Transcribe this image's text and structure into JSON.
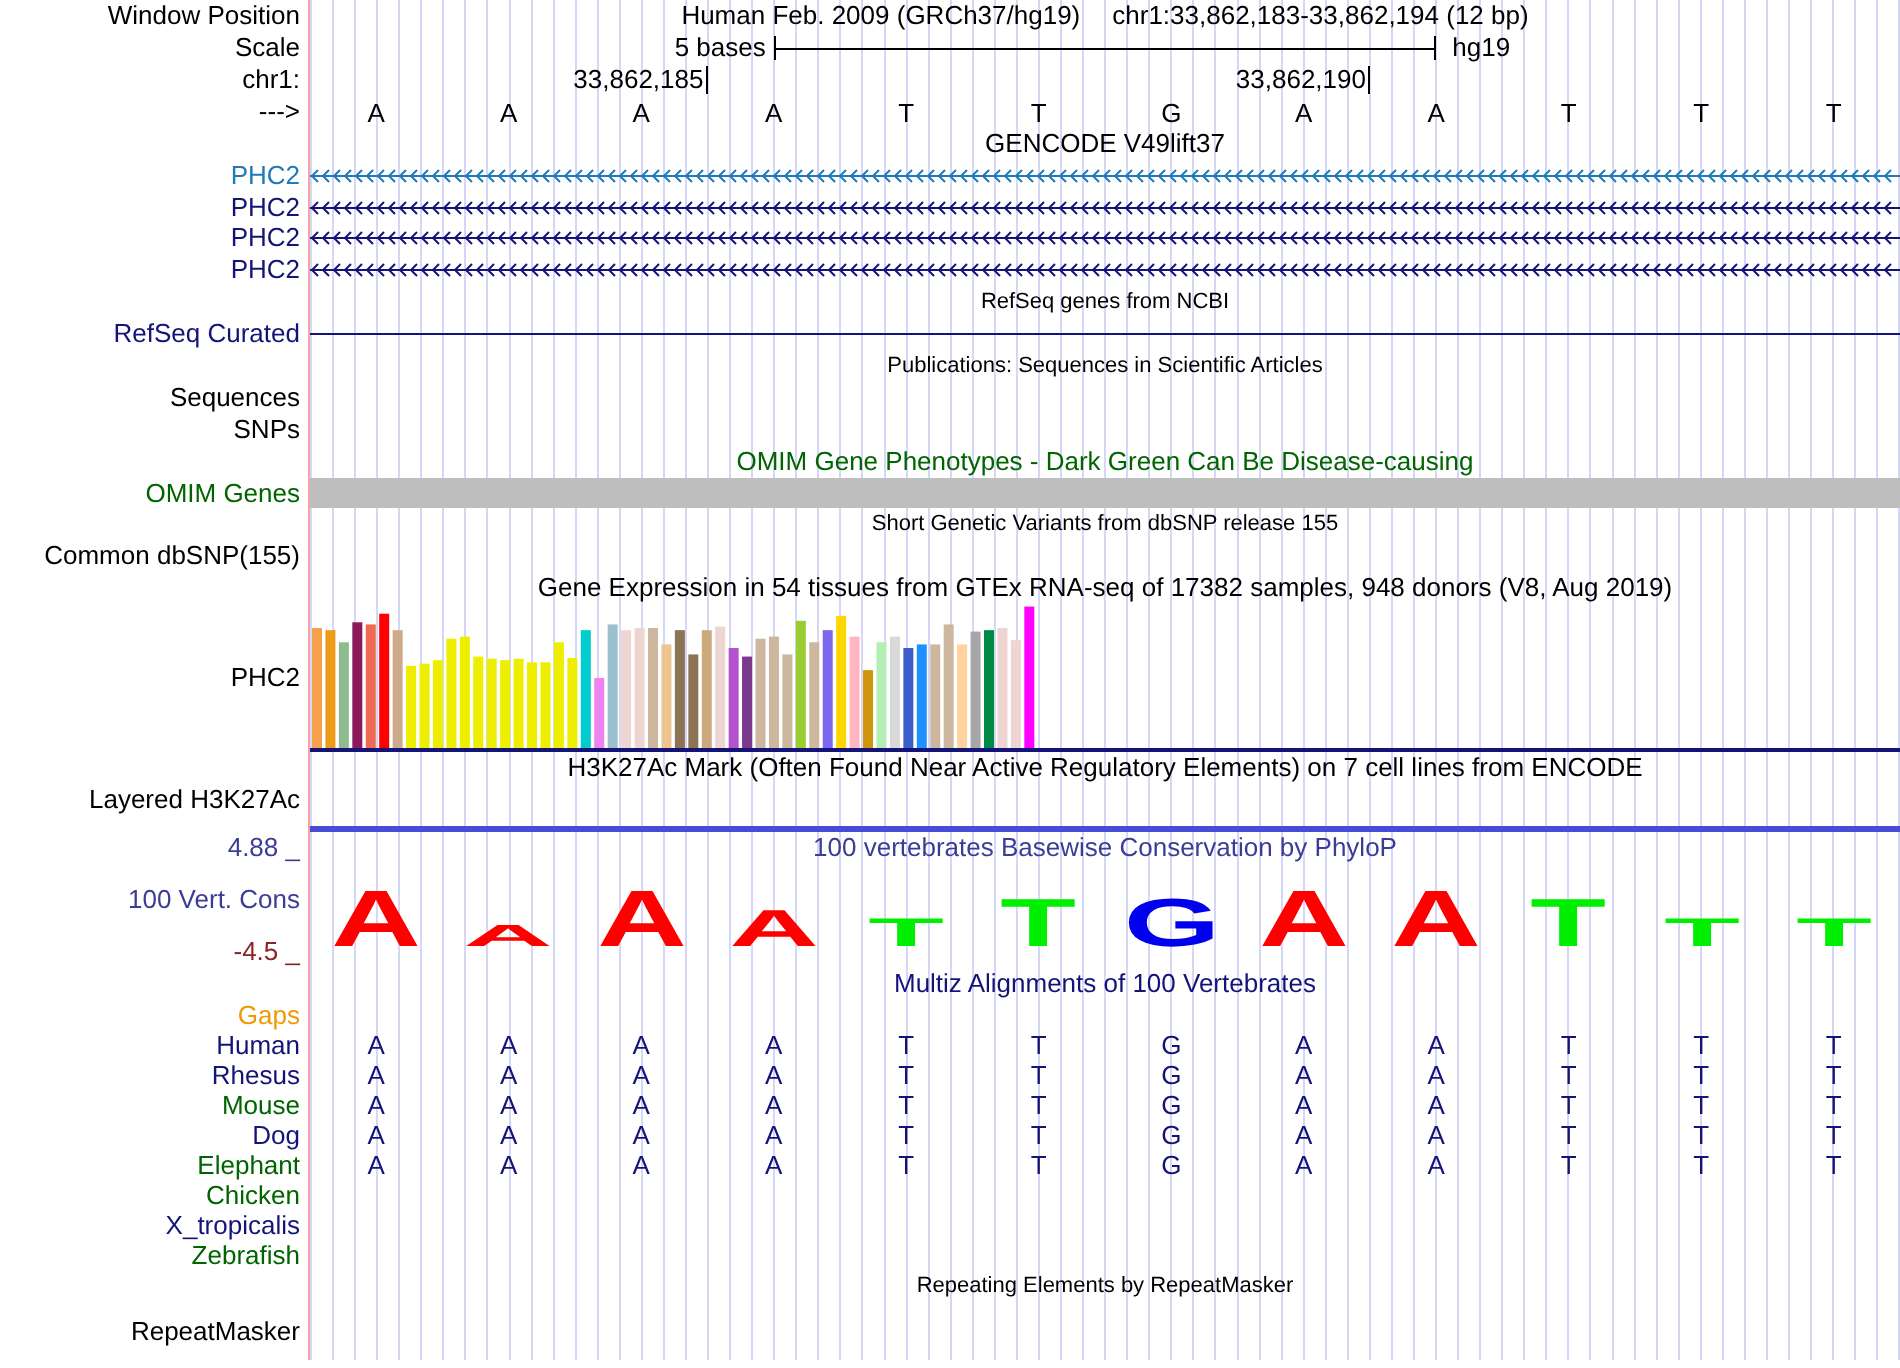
{
  "header": {
    "window_position_label": "Window Position",
    "assembly": "Human Feb. 2009 (GRCh37/hg19)",
    "position": "chr1:33,862,183-33,862,194 (12 bp)",
    "scale_label": "Scale",
    "scale_text": "5 bases",
    "scale_db": "hg19",
    "chrom_label": "chr1:",
    "coord_ticks": [
      "33,862,185",
      "33,862,190"
    ],
    "strand_label": "--->",
    "bases": [
      "A",
      "A",
      "A",
      "A",
      "T",
      "T",
      "G",
      "A",
      "A",
      "T",
      "T",
      "T"
    ]
  },
  "tracks": [
    {
      "kind": "genes",
      "title": "GENCODE V49lift37",
      "strand_arrows": true,
      "items": [
        {
          "label": "PHC2",
          "color": "#1e7ab8"
        },
        {
          "label": "PHC2",
          "color": "#141478"
        },
        {
          "label": "PHC2",
          "color": "#141478"
        },
        {
          "label": "PHC2",
          "color": "#141478"
        }
      ]
    },
    {
      "kind": "genes",
      "title": "RefSeq genes from NCBI",
      "strand_arrows": false,
      "items": [
        {
          "label": "RefSeq Curated",
          "color": "#141478"
        }
      ]
    },
    {
      "kind": "labels",
      "title": "Publications: Sequences in Scientific Articles",
      "items": [
        {
          "label": "Sequences"
        },
        {
          "label": "SNPs"
        }
      ]
    },
    {
      "kind": "bar",
      "title": "OMIM Gene Phenotypes - Dark Green Can Be Disease-causing",
      "color": "#006400",
      "items": [
        {
          "label": "OMIM Genes",
          "color": "#006400"
        }
      ]
    },
    {
      "kind": "labels",
      "title": "Short Genetic Variants from dbSNP release 155",
      "items": [
        {
          "label": "Common dbSNP(155)"
        }
      ]
    },
    {
      "kind": "expression",
      "title": "Gene Expression in 54 tissues from GTEx RNA-seq of 17382 samples, 948 donors (V8, Aug 2019)",
      "items": [
        {
          "label": "PHC2"
        }
      ]
    },
    {
      "kind": "signal",
      "title": "H3K27Ac Mark (Often Found Near Active Regulatory Elements) on 7 cell lines from ENCODE",
      "items": [
        {
          "label": "Layered H3K27Ac"
        }
      ]
    },
    {
      "kind": "logo",
      "title": "100 vertebrates Basewise Conservation by PhyloP",
      "color": "#3c3c96",
      "label": "100 Vert. Cons",
      "ymax": "4.88 _",
      "ymin": "-4.5 _",
      "logo": [
        {
          "base": "A",
          "color": "#ff0000"
        },
        {
          "base": "A",
          "color": "#ff0000"
        },
        {
          "base": "A",
          "color": "#ff0000"
        },
        {
          "base": "A",
          "color": "#ff0000"
        },
        {
          "base": "T",
          "color": "#00ee00"
        },
        {
          "base": "T",
          "color": "#00ee00"
        },
        {
          "base": "G",
          "color": "#0000ee"
        },
        {
          "base": "A",
          "color": "#ff0000"
        },
        {
          "base": "A",
          "color": "#ff0000"
        },
        {
          "base": "T",
          "color": "#00ee00"
        },
        {
          "base": "T",
          "color": "#00ee00"
        },
        {
          "base": "T",
          "color": "#00ee00"
        }
      ]
    },
    {
      "kind": "alignment",
      "title": "Multiz Alignments of 100 Vertebrates",
      "color": "#141478",
      "items": [
        {
          "label": "Gaps",
          "color": "#ee9a00"
        },
        {
          "label": "Human",
          "color": "#141478",
          "bases": [
            "A",
            "A",
            "A",
            "A",
            "T",
            "T",
            "G",
            "A",
            "A",
            "T",
            "T",
            "T"
          ]
        },
        {
          "label": "Rhesus",
          "color": "#141478",
          "bases": [
            "A",
            "A",
            "A",
            "A",
            "T",
            "T",
            "G",
            "A",
            "A",
            "T",
            "T",
            "T"
          ]
        },
        {
          "label": "Mouse",
          "color": "#006400",
          "bases": [
            "A",
            "A",
            "A",
            "A",
            "T",
            "T",
            "G",
            "A",
            "A",
            "T",
            "T",
            "T"
          ]
        },
        {
          "label": "Dog",
          "color": "#141478",
          "bases": [
            "A",
            "A",
            "A",
            "A",
            "T",
            "T",
            "G",
            "A",
            "A",
            "T",
            "T",
            "T"
          ]
        },
        {
          "label": "Elephant",
          "color": "#006400",
          "bases": [
            "A",
            "A",
            "A",
            "A",
            "T",
            "T",
            "G",
            "A",
            "A",
            "T",
            "T",
            "T"
          ]
        },
        {
          "label": "Chicken",
          "color": "#006400"
        },
        {
          "label": "X_tropicalis",
          "color": "#141478"
        },
        {
          "label": "Zebrafish",
          "color": "#006400"
        }
      ]
    },
    {
      "kind": "labels",
      "title": "Repeating Elements by RepeatMasker",
      "items": [
        {
          "label": "RepeatMasker"
        }
      ]
    }
  ]
}
